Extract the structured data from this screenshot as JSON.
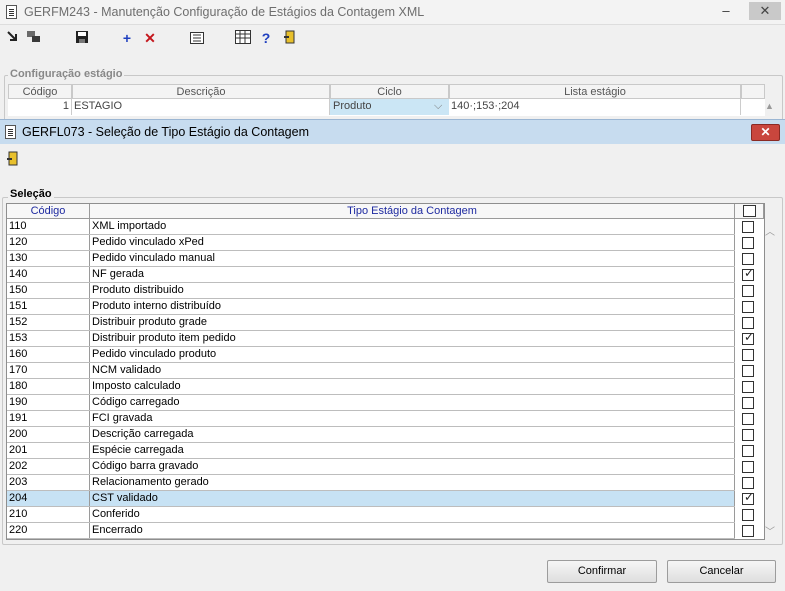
{
  "bg_window": {
    "title": "GERFM243 - Manutenção Configuração de Estágios da Contagem XML",
    "controls": {
      "minimize": "–",
      "close": "✕"
    },
    "toolbar_icons": [
      "enter-arrow-icon",
      "copy-windows-icon",
      "save-icon",
      "add-icon",
      "delete-icon",
      "details-icon",
      "calendar-grid-icon",
      "help-icon",
      "exit-door-icon"
    ],
    "toolbar_glyphs": {
      "add": "+",
      "delete": "✕",
      "help": "?"
    },
    "group_label": "Configuração estágio",
    "columns": [
      "Código",
      "Descrição",
      "Ciclo",
      "Lista estágio"
    ],
    "row": {
      "codigo": "1",
      "descricao": "ESTAGIO",
      "ciclo": "Produto",
      "lista": "140·;153·;204"
    }
  },
  "dialog": {
    "title": "GERFL073 - Seleção de Tipo Estágio da Contagem",
    "close_label": "✕",
    "group_label": "Seleção",
    "columns": {
      "codigo": "Código",
      "tipo": "Tipo Estágio da Contagem"
    },
    "rows": [
      {
        "codigo": "110",
        "tipo": "XML importado",
        "checked": false
      },
      {
        "codigo": "120",
        "tipo": "Pedido vinculado xPed",
        "checked": false
      },
      {
        "codigo": "130",
        "tipo": "Pedido vinculado manual",
        "checked": false
      },
      {
        "codigo": "140",
        "tipo": "NF gerada",
        "checked": true
      },
      {
        "codigo": "150",
        "tipo": "Produto distribuido",
        "checked": false
      },
      {
        "codigo": "151",
        "tipo": "Produto interno distribuído",
        "checked": false
      },
      {
        "codigo": "152",
        "tipo": "Distribuir produto grade",
        "checked": false
      },
      {
        "codigo": "153",
        "tipo": "Distribuir produto item pedido",
        "checked": true
      },
      {
        "codigo": "160",
        "tipo": "Pedido vinculado produto",
        "checked": false
      },
      {
        "codigo": "170",
        "tipo": "NCM validado",
        "checked": false
      },
      {
        "codigo": "180",
        "tipo": "Imposto calculado",
        "checked": false
      },
      {
        "codigo": "190",
        "tipo": "Código carregado",
        "checked": false
      },
      {
        "codigo": "191",
        "tipo": "FCI gravada",
        "checked": false
      },
      {
        "codigo": "200",
        "tipo": "Descrição carregada",
        "checked": false
      },
      {
        "codigo": "201",
        "tipo": "Espécie carregada",
        "checked": false
      },
      {
        "codigo": "202",
        "tipo": "Código barra gravado",
        "checked": false
      },
      {
        "codigo": "203",
        "tipo": "Relacionamento gerado",
        "checked": false
      },
      {
        "codigo": "204",
        "tipo": "CST validado",
        "checked": true,
        "selected": true
      },
      {
        "codigo": "210",
        "tipo": "Conferido",
        "checked": false
      },
      {
        "codigo": "220",
        "tipo": "Encerrado",
        "checked": false
      }
    ],
    "buttons": {
      "confirm": "Confirmar",
      "cancel": "Cancelar"
    }
  },
  "colors": {
    "selection": "#c7e2f4",
    "dialog_title": "#c7dcef",
    "close": "#c9463d",
    "header_text": "#1e2aa0"
  }
}
